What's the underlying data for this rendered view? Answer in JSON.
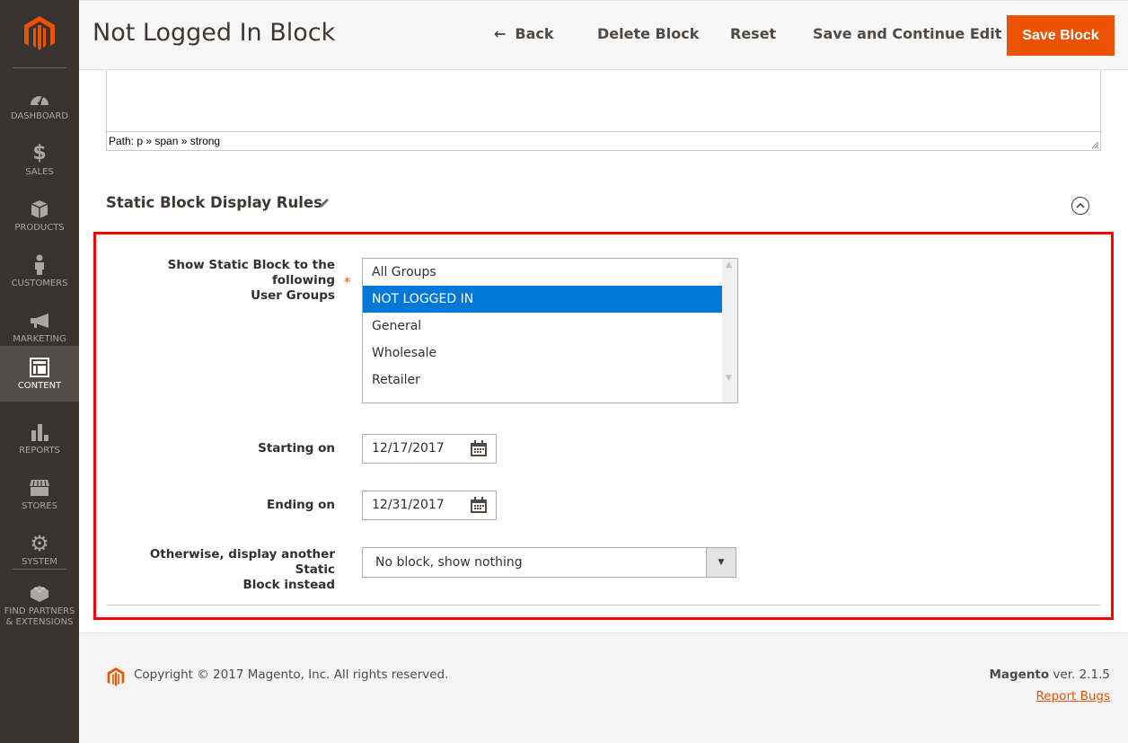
{
  "sidebar": {
    "items": [
      {
        "label": "DASHBOARD",
        "icon": "dashboard-icon"
      },
      {
        "label": "SALES",
        "icon": "dollar-icon"
      },
      {
        "label": "PRODUCTS",
        "icon": "box-icon"
      },
      {
        "label": "CUSTOMERS",
        "icon": "person-icon"
      },
      {
        "label": "MARKETING",
        "icon": "megaphone-icon"
      },
      {
        "label": "CONTENT",
        "icon": "layout-icon",
        "active": true
      },
      {
        "label": "REPORTS",
        "icon": "bar-chart-icon"
      },
      {
        "label": "STORES",
        "icon": "storefront-icon"
      },
      {
        "label": "SYSTEM",
        "icon": "gear-icon"
      },
      {
        "label": "FIND PARTNERS & EXTENSIONS",
        "icon": "lego-brick-icon"
      }
    ]
  },
  "header": {
    "title": "Not Logged In Block",
    "back_label": "Back",
    "delete_label": "Delete Block",
    "reset_label": "Reset",
    "save_continue_label": "Save and Continue Edit",
    "save_label": "Save Block"
  },
  "editor": {
    "path": "Path: p » span » strong"
  },
  "section": {
    "title": "Static Block Display Rules",
    "user_groups_label_line1": "Show Static Block to the following",
    "user_groups_label_line2": "User Groups",
    "required_mark": "*",
    "user_groups": [
      {
        "label": "All Groups",
        "selected": false
      },
      {
        "label": "NOT LOGGED IN",
        "selected": true
      },
      {
        "label": "General",
        "selected": false
      },
      {
        "label": "Wholesale",
        "selected": false
      },
      {
        "label": "Retailer",
        "selected": false
      }
    ],
    "starting_label": "Starting on",
    "starting_value": "12/17/2017",
    "ending_label": "Ending on",
    "ending_value": "12/31/2017",
    "otherwise_label_line1": "Otherwise, display another Static",
    "otherwise_label_line2": "Block instead",
    "otherwise_value": "No block, show nothing"
  },
  "footer": {
    "copyright": "Copyright © 2017 Magento, Inc. All rights reserved.",
    "brand": "Magento",
    "version": " ver. 2.1.5",
    "report_bugs": "Report Bugs"
  },
  "colors": {
    "accent": "#eb5202",
    "sidebar_bg": "#373330",
    "selected_option": "#0078d7",
    "highlight_border": "#ff0000"
  }
}
